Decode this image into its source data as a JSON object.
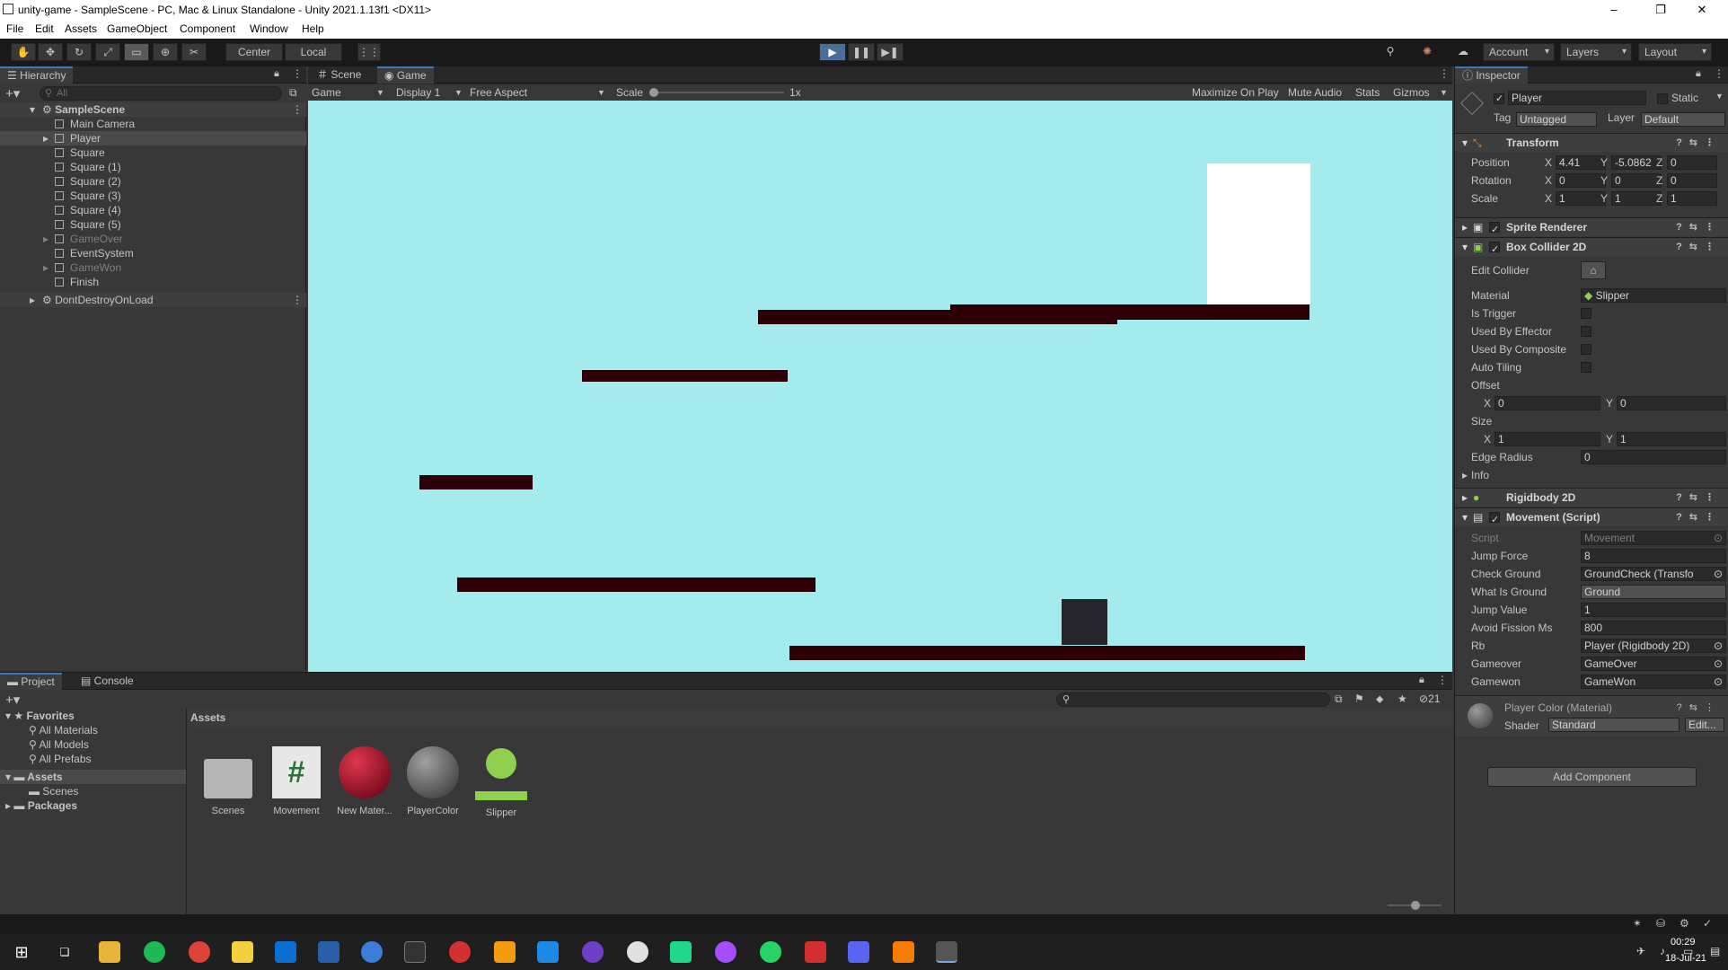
{
  "window": {
    "title": "unity-game - SampleScene - PC, Mac & Linux Standalone - Unity 2021.1.13f1 <DX11>",
    "minimize": "–",
    "maximize": "❐",
    "close": "✕"
  },
  "menu": [
    "File",
    "Edit",
    "Assets",
    "GameObject",
    "Component",
    "Window",
    "Help"
  ],
  "toolbar": {
    "pivot": "Center",
    "space": "Local",
    "account": "Account",
    "layers": "Layers",
    "layout": "Layout"
  },
  "hierarchy": {
    "tab": "Hierarchy",
    "search_placeholder": "All",
    "scene": "SampleScene",
    "items": [
      {
        "label": "Main Camera",
        "dim": false,
        "selected": false,
        "expand": false
      },
      {
        "label": "Player",
        "dim": false,
        "selected": true,
        "expand": true
      },
      {
        "label": "Square",
        "dim": false,
        "selected": false,
        "expand": false
      },
      {
        "label": "Square (1)",
        "dim": false,
        "selected": false,
        "expand": false
      },
      {
        "label": "Square (2)",
        "dim": false,
        "selected": false,
        "expand": false
      },
      {
        "label": "Square (3)",
        "dim": false,
        "selected": false,
        "expand": false
      },
      {
        "label": "Square (4)",
        "dim": false,
        "selected": false,
        "expand": false
      },
      {
        "label": "Square (5)",
        "dim": false,
        "selected": false,
        "expand": false
      },
      {
        "label": "GameOver",
        "dim": true,
        "selected": false,
        "expand": true
      },
      {
        "label": "EventSystem",
        "dim": false,
        "selected": false,
        "expand": false
      },
      {
        "label": "GameWon",
        "dim": true,
        "selected": false,
        "expand": true
      },
      {
        "label": "Finish",
        "dim": false,
        "selected": false,
        "expand": false
      }
    ],
    "dontdestroy": "DontDestroyOnLoad"
  },
  "game": {
    "tabs": {
      "scene": "Scene",
      "game": "Game"
    },
    "mode": "Game",
    "display": "Display 1",
    "aspect": "Free Aspect",
    "scale_label": "Scale",
    "scale_value": "1x",
    "maximize": "Maximize On Play",
    "mute": "Mute Audio",
    "stats": "Stats",
    "gizmos": "Gizmos",
    "colors": {
      "sky": "#a3ebec",
      "platform": "#2d0006",
      "player": "#25252b",
      "finish": "#ffffff"
    }
  },
  "inspector": {
    "tab": "Inspector",
    "object_name": "Player",
    "static_label": "Static",
    "tag_label": "Tag",
    "tag_value": "Untagged",
    "layer_label": "Layer",
    "layer_value": "Default",
    "transform": {
      "title": "Transform",
      "position": {
        "label": "Position",
        "x": "4.41",
        "y": "-5.0862",
        "z": "0"
      },
      "rotation": {
        "label": "Rotation",
        "x": "0",
        "y": "0",
        "z": "0"
      },
      "scale": {
        "label": "Scale",
        "x": "1",
        "y": "1",
        "z": "1"
      }
    },
    "sprite_renderer": "Sprite Renderer",
    "box_collider": {
      "title": "Box Collider 2D",
      "edit_collider": "Edit Collider",
      "material_label": "Material",
      "material_value": "Slipper",
      "is_trigger": "Is Trigger",
      "used_by_effector": "Used By Effector",
      "used_by_composite": "Used By Composite",
      "auto_tiling": "Auto Tiling",
      "offset": {
        "label": "Offset",
        "x": "0",
        "y": "0"
      },
      "size": {
        "label": "Size",
        "x": "1",
        "y": "1"
      },
      "edge_radius_label": "Edge Radius",
      "edge_radius_value": "0",
      "info": "Info"
    },
    "rigidbody": "Rigidbody 2D",
    "movement": {
      "title": "Movement (Script)",
      "fields": [
        {
          "label": "Script",
          "value": "Movement",
          "dim": true,
          "ref": true
        },
        {
          "label": "Jump Force",
          "value": "8",
          "dim": false,
          "ref": false
        },
        {
          "label": "Check Ground",
          "value": "GroundCheck (Transfo",
          "dim": false,
          "ref": true
        },
        {
          "label": "What Is Ground",
          "value": "Ground",
          "dim": false,
          "ref": false
        },
        {
          "label": "Jump Value",
          "value": "1",
          "dim": false,
          "ref": false
        },
        {
          "label": "Avoid Fission Ms",
          "value": "800",
          "dim": false,
          "ref": false
        },
        {
          "label": "Rb",
          "value": "Player (Rigidbody 2D)",
          "dim": false,
          "ref": true
        },
        {
          "label": "Gameover",
          "value": "GameOver",
          "dim": false,
          "ref": true
        },
        {
          "label": "Gamewon",
          "value": "GameWon",
          "dim": false,
          "ref": true
        }
      ]
    },
    "material": {
      "title": "Player Color (Material)",
      "shader_label": "Shader",
      "shader_value": "Standard",
      "edit": "Edit..."
    },
    "add_component": "Add Component"
  },
  "project": {
    "tabs": {
      "project": "Project",
      "console": "Console"
    },
    "hidden_count": "21",
    "favorites": "Favorites",
    "favorite_items": [
      "All Materials",
      "All Models",
      "All Prefabs"
    ],
    "assets_root": "Assets",
    "tree_scenes": "Scenes",
    "packages": "Packages",
    "breadcrumb": "Assets",
    "assets": [
      {
        "label": "Scenes",
        "kind": "folder"
      },
      {
        "label": "Movement",
        "kind": "script"
      },
      {
        "label": "New Mater...",
        "kind": "red"
      },
      {
        "label": "PlayerColor",
        "kind": "grey"
      },
      {
        "label": "Slipper",
        "kind": "physics"
      }
    ]
  },
  "taskbar": {
    "time": "00:29",
    "date": "18-Jul-21"
  }
}
